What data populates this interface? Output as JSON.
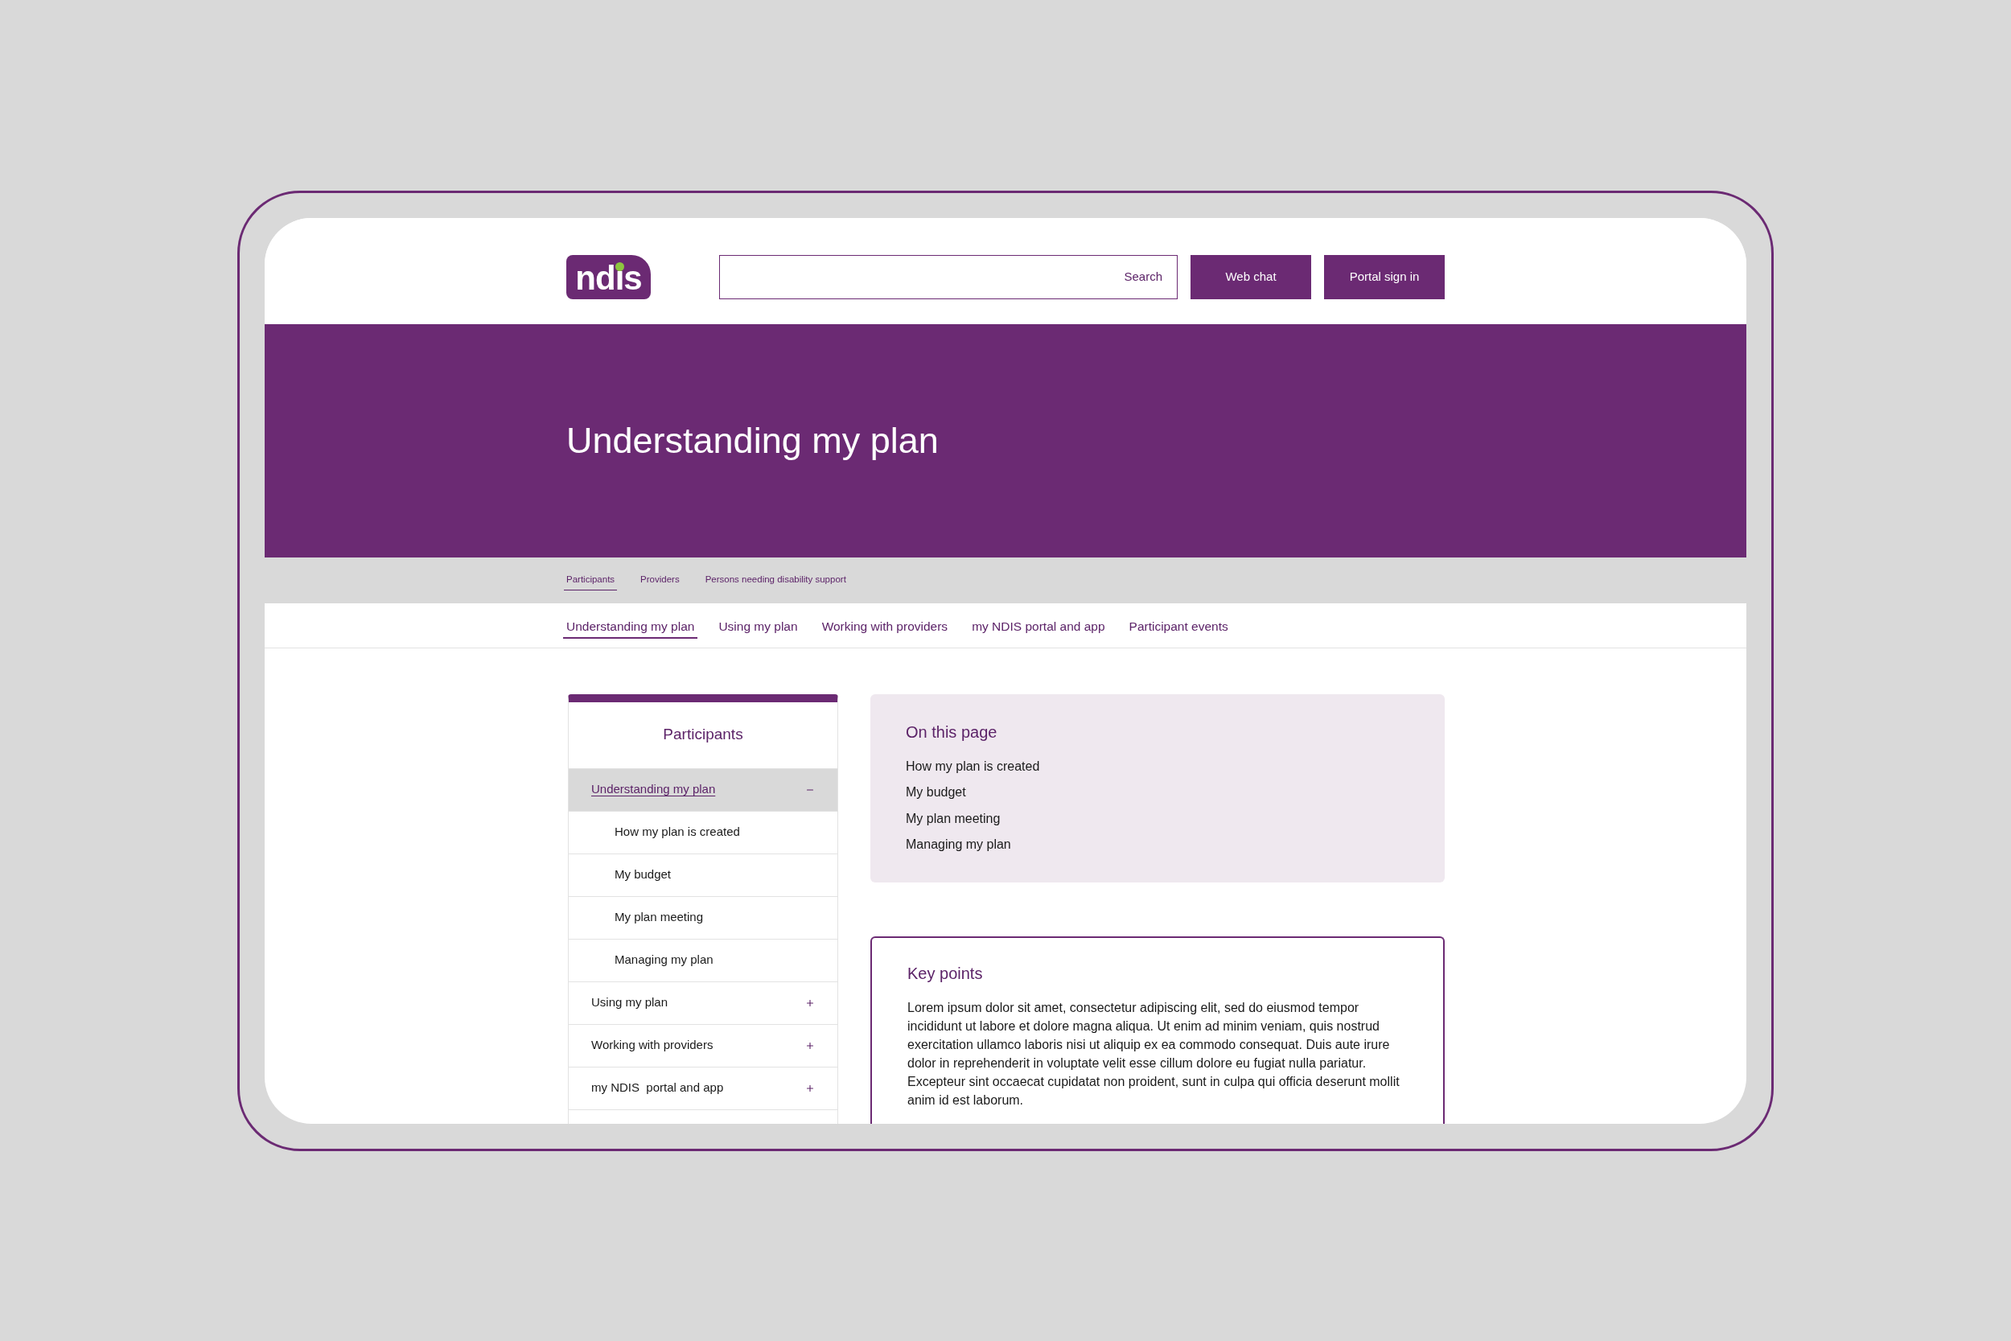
{
  "header": {
    "logo": "ndis",
    "search": {
      "button": "Search"
    },
    "buttons": [
      {
        "label": "Web chat"
      },
      {
        "label": "Portal sign in"
      }
    ]
  },
  "hero": {
    "title": "Understanding my plan"
  },
  "audience_tabs": [
    {
      "label": "Participants",
      "selected": true
    },
    {
      "label": "Providers",
      "selected": false
    },
    {
      "label": "Persons needing disability support",
      "selected": false
    }
  ],
  "section_nav": [
    {
      "label": "Understanding my plan",
      "selected": true
    },
    {
      "label": "Using my plan",
      "selected": false
    },
    {
      "label": "Working with providers",
      "selected": false
    },
    {
      "label": "my NDIS portal and app",
      "selected": false
    },
    {
      "label": "Participant events",
      "selected": false
    }
  ],
  "sidebar": {
    "title": "Participants",
    "items": [
      {
        "label": "Understanding my plan",
        "selected": true,
        "expanded": true,
        "children": [
          {
            "label": "How my plan is created",
            "selected": false
          },
          {
            "label": "My budget",
            "selected": false
          },
          {
            "label": "My plan meeting",
            "selected": false
          },
          {
            "label": "Managing my plan",
            "selected": false
          }
        ]
      },
      {
        "label": "Using my plan",
        "selected": false,
        "expanded": false
      },
      {
        "label": "Working with providers",
        "selected": false,
        "expanded": false
      },
      {
        "label": "my NDIS  portal and app",
        "selected": false,
        "expanded": false
      }
    ]
  },
  "on_this_page": {
    "title": "On this page",
    "links": [
      "How my plan is created",
      "My budget",
      "My plan meeting",
      "Managing my plan"
    ]
  },
  "key_points": {
    "title": "Key points",
    "text": "Lorem ipsum dolor sit amet, consectetur adipiscing elit, sed do eiusmod tempor incididunt ut labore et dolore magna aliqua. Ut enim ad minim veniam, quis nostrud exercitation ullamco laboris nisi ut aliquip ex ea commodo consequat. Duis aute irure dolor in reprehenderit in voluptate velit esse cillum dolore eu fugiat nulla pariatur. Excepteur sint occaecat cupidatat non proident, sunt in culpa qui officia deserunt mollit anim id est laborum."
  }
}
